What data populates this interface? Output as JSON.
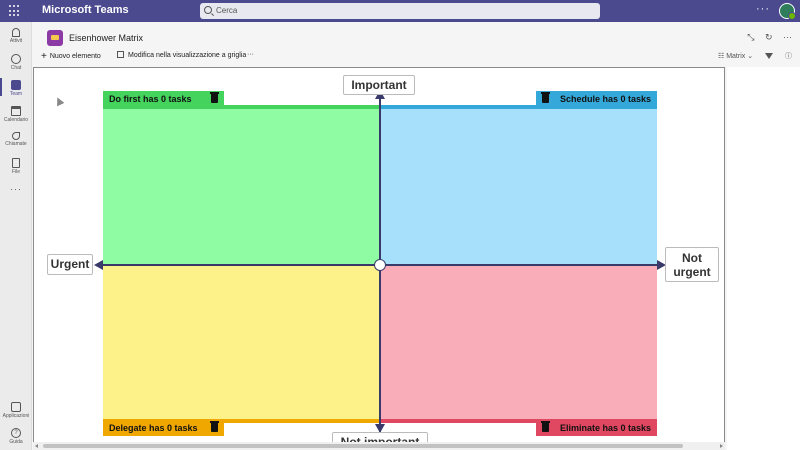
{
  "app": {
    "name": "Microsoft Teams",
    "search_placeholder": "Cerca",
    "more": "···"
  },
  "rail": {
    "items": [
      {
        "label": "Attivit",
        "icon": "bell-icon"
      },
      {
        "label": "Chat",
        "icon": "chat-icon"
      },
      {
        "label": "Team",
        "icon": "teams-icon"
      },
      {
        "label": "Calendario",
        "icon": "calendar-icon"
      },
      {
        "label": "Chiamate",
        "icon": "phone-icon"
      },
      {
        "label": "File",
        "icon": "file-icon"
      }
    ],
    "more": "···",
    "apps_label": "Applicazioni",
    "help_label": "Guida"
  },
  "tab": {
    "title": "Eisenhower Matrix"
  },
  "toolbar": {
    "new_item": "Nuovo elemento",
    "grid_edit": "Modifica nella visualizzazione a griglia",
    "more": "···",
    "view": "Matrix"
  },
  "matrix": {
    "axes": {
      "top": "Important",
      "bottom": "Not important",
      "left": "Urgent",
      "right_line1": "Not",
      "right_line2": "urgent"
    },
    "quadrants": {
      "do_first": "Do first has 0 tasks",
      "schedule": "Schedule has 0 tasks",
      "delegate": "Delegate has 0 tasks",
      "eliminate": "Eliminate has 0 tasks"
    },
    "colors": {
      "do_first": "#8ffba2",
      "schedule": "#a7e0fa",
      "delegate": "#fdf189",
      "eliminate": "#f8adb8"
    }
  }
}
